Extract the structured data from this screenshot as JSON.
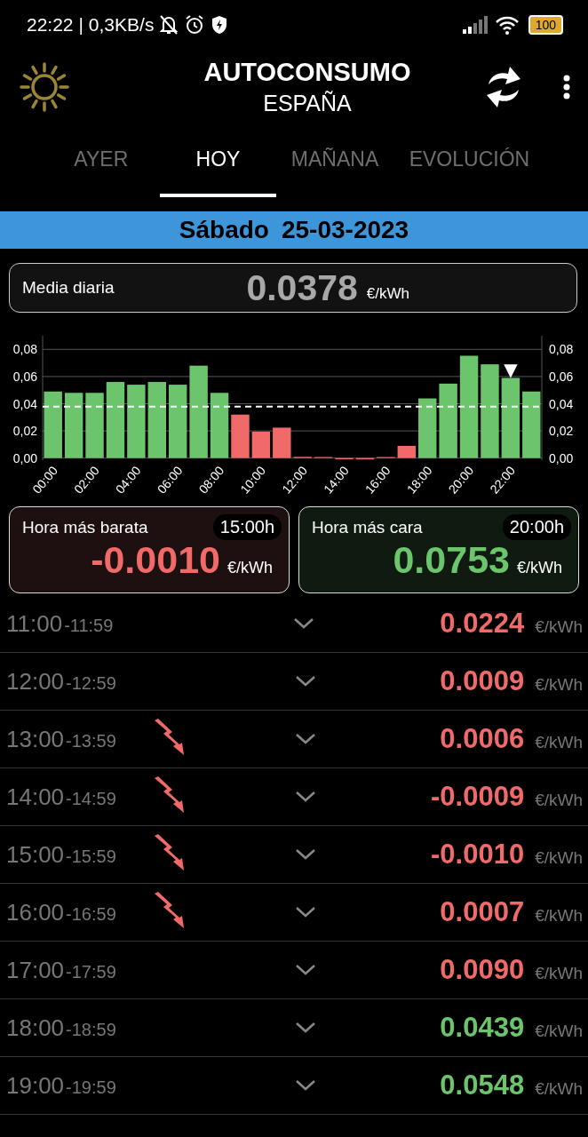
{
  "status_bar": {
    "time": "22:22",
    "speed": "| 0,3KB/s",
    "battery": "100"
  },
  "header": {
    "title": "AUTOCONSUMO",
    "subtitle": "ESPAÑA"
  },
  "tabs": [
    {
      "label": "AYER",
      "selected": false
    },
    {
      "label": "HOY",
      "selected": true
    },
    {
      "label": "MAÑANA",
      "selected": false
    },
    {
      "label": "EVOLUCIÓN",
      "selected": false
    }
  ],
  "date_bar": {
    "weekday": "Sábado",
    "date": "25-03-2023"
  },
  "daily_average": {
    "label": "Media diaria",
    "value": "0.0378",
    "unit": "€/kWh"
  },
  "chart": {
    "chart_data": {
      "type": "bar",
      "grid": true,
      "xlim": [
        -0.5,
        23.5
      ],
      "x": [
        0,
        1,
        2,
        3,
        4,
        5,
        6,
        7,
        8,
        9,
        10,
        11,
        12,
        13,
        14,
        15,
        16,
        17,
        18,
        19,
        20,
        21,
        22,
        23
      ],
      "series": [
        {
          "color": "#6cc56c",
          "values": [
            0.049,
            0.048,
            0.048,
            0.056,
            0.054,
            0.056,
            0.054,
            0.068,
            0.048,
            null,
            null,
            null,
            null,
            null,
            null,
            null,
            null,
            null,
            0.0439,
            0.0548,
            0.0753,
            0.069,
            0.059,
            0.049
          ]
        },
        {
          "color": "#f06a6a",
          "values": [
            null,
            null,
            null,
            null,
            null,
            null,
            null,
            null,
            null,
            0.032,
            0.0195,
            0.0224,
            0.0009,
            0.0006,
            -0.0009,
            -0.001,
            0.0007,
            0.009,
            null,
            null,
            null,
            null,
            null,
            null
          ]
        }
      ],
      "ylim": [
        -0.0015,
        0.09
      ],
      "xticks": [
        {
          "value": 0,
          "label": "00:00"
        },
        {
          "value": 2,
          "label": "02:00"
        },
        {
          "value": 4,
          "label": "04:00"
        },
        {
          "value": 6,
          "label": "06:00"
        },
        {
          "value": 8,
          "label": "08:00"
        },
        {
          "value": 10,
          "label": "10:00"
        },
        {
          "value": 12,
          "label": "12:00"
        },
        {
          "value": 14,
          "label": "14:00"
        },
        {
          "value": 16,
          "label": "16:00"
        },
        {
          "value": 18,
          "label": "18:00"
        },
        {
          "value": 20,
          "label": "20:00"
        },
        {
          "value": 22,
          "label": "22:00"
        }
      ],
      "yticks": [
        {
          "value": 0,
          "label": "0,00"
        },
        {
          "value": 0.02,
          "label": "0,02"
        },
        {
          "value": 0.04,
          "label": "0,04"
        },
        {
          "value": 0.06,
          "label": "0,06"
        },
        {
          "value": 0.08,
          "label": "0,08"
        }
      ],
      "ref_lines": [
        {
          "axis": "y",
          "value": 0.0378
        }
      ],
      "annotations": [
        {
          "x": 22,
          "y": 0.059,
          "text": "▼"
        }
      ]
    }
  },
  "extremes": [
    {
      "kind": "cheap",
      "label": "Hora más barata",
      "time": "15:00h",
      "value": "-0.0010",
      "unit": "€/kWh",
      "color": "#f06a6a"
    },
    {
      "kind": "expensive",
      "label": "Hora más cara",
      "time": "20:00h",
      "value": "0.0753",
      "unit": "€/kWh",
      "color": "#6cc56c"
    }
  ],
  "hours": [
    {
      "start": "11:00",
      "end": "-11:59",
      "bolt": false,
      "price": "0.0224",
      "unit": "€/kWh",
      "color": "#f06a6a"
    },
    {
      "start": "12:00",
      "end": "-12:59",
      "bolt": false,
      "price": "0.0009",
      "unit": "€/kWh",
      "color": "#f06a6a"
    },
    {
      "start": "13:00",
      "end": "-13:59",
      "bolt": true,
      "price": "0.0006",
      "unit": "€/kWh",
      "color": "#f06a6a"
    },
    {
      "start": "14:00",
      "end": "-14:59",
      "bolt": true,
      "price": "-0.0009",
      "unit": "€/kWh",
      "color": "#f06a6a"
    },
    {
      "start": "15:00",
      "end": "-15:59",
      "bolt": true,
      "price": "-0.0010",
      "unit": "€/kWh",
      "color": "#f06a6a"
    },
    {
      "start": "16:00",
      "end": "-16:59",
      "bolt": true,
      "price": "0.0007",
      "unit": "€/kWh",
      "color": "#f06a6a"
    },
    {
      "start": "17:00",
      "end": "-17:59",
      "bolt": false,
      "price": "0.0090",
      "unit": "€/kWh",
      "color": "#f06a6a"
    },
    {
      "start": "18:00",
      "end": "-18:59",
      "bolt": false,
      "price": "0.0439",
      "unit": "€/kWh",
      "color": "#6cc56c"
    },
    {
      "start": "19:00",
      "end": "-19:59",
      "bolt": false,
      "price": "0.0548",
      "unit": "€/kWh",
      "color": "#6cc56c"
    }
  ]
}
